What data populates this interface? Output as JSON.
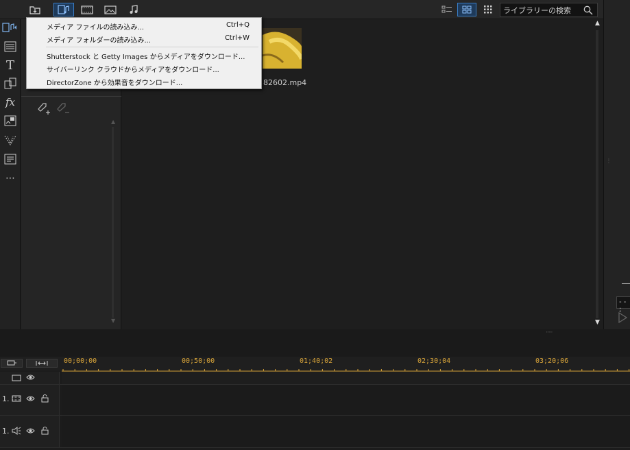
{
  "toolbar": {
    "import_icon": "import-media-icon",
    "tabs": [
      "media-library-icon",
      "video-icon",
      "image-icon",
      "music-icon"
    ],
    "search_placeholder": "ライブラリーの検索"
  },
  "menu": {
    "items": [
      {
        "label": "メディア ファイルの読み込み...",
        "shortcut": "Ctrl+Q"
      },
      {
        "label": "メディア フォルダーの読み込み...",
        "shortcut": "Ctrl+W"
      },
      {
        "label": "Shutterstock と Getty Images からメディアをダウンロード...",
        "shortcut": ""
      },
      {
        "label": "サイバーリンク クラウドからメディアをダウンロード...",
        "shortcut": ""
      },
      {
        "label": "DirectorZone から効果音をダウンロード...",
        "shortcut": ""
      }
    ]
  },
  "library": {
    "clip_caption": "82602.mp4"
  },
  "timeline": {
    "ticks": [
      "00;00;00",
      "00;50;00",
      "01;40;02",
      "02;30;04",
      "03;20;06"
    ],
    "tracks": [
      {
        "number": "1."
      },
      {
        "number": "1."
      }
    ]
  },
  "right_panel": {
    "timecode": "- - ;"
  },
  "left_icons": [
    "media-room-icon",
    "title-icon",
    "text-T-icon",
    "transition-icon",
    "fx-icon",
    "pip-icon",
    "particle-icon",
    "subtitle-icon",
    "more-icon"
  ],
  "colors": {
    "accent": "#3a7fc8",
    "timecode": "#d9a53a"
  }
}
